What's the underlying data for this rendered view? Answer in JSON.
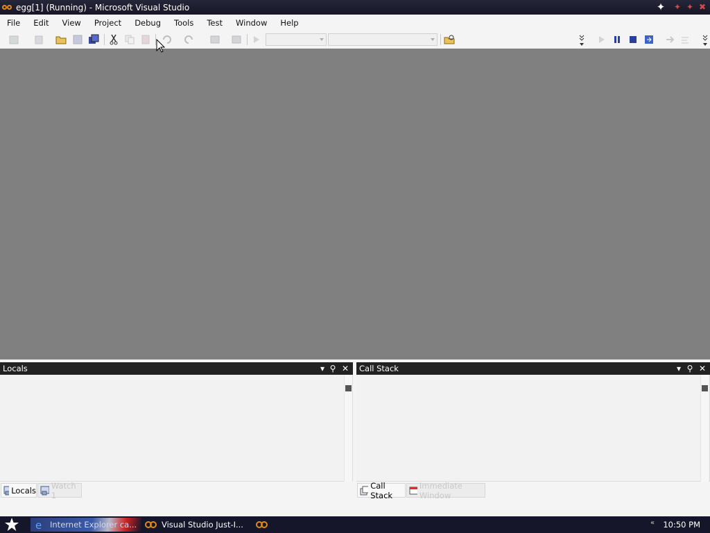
{
  "window": {
    "title": "egg[1] (Running) - Microsoft Visual Studio"
  },
  "menu": [
    "File",
    "Edit",
    "View",
    "Project",
    "Debug",
    "Tools",
    "Test",
    "Window",
    "Help"
  ],
  "panes": {
    "locals": {
      "title": "Locals"
    },
    "callstack": {
      "title": "Call Stack"
    }
  },
  "tabs": {
    "left": {
      "active": "Locals",
      "inactive": "Watch 1"
    },
    "right": {
      "active": "Call Stack",
      "inactive": "Immediate Window"
    }
  },
  "taskbar": {
    "items": [
      "Internet Explorer ca...",
      "Visual Studio Just-I..."
    ],
    "clock": "10:50 PM"
  },
  "icons": {
    "start": "star-icon",
    "toolbar": [
      "new-project-icon",
      "add-item-icon",
      "open-file-icon",
      "save-icon",
      "save-all-icon",
      "cut-icon",
      "copy-icon",
      "paste-icon",
      "undo-icon",
      "redo-icon",
      "navigate-backward-icon",
      "navigate-forward-icon",
      "start-debugging-icon",
      "find-in-files-icon",
      "break-all-icon",
      "stop-debugging-icon",
      "restart-icon",
      "show-next-statement-icon",
      "step-into-icon"
    ]
  },
  "colors": {
    "titlebar": "#1e1e30",
    "editor_bg": "#808080",
    "pane_header": "#222222",
    "taskbar": "#16162a"
  }
}
